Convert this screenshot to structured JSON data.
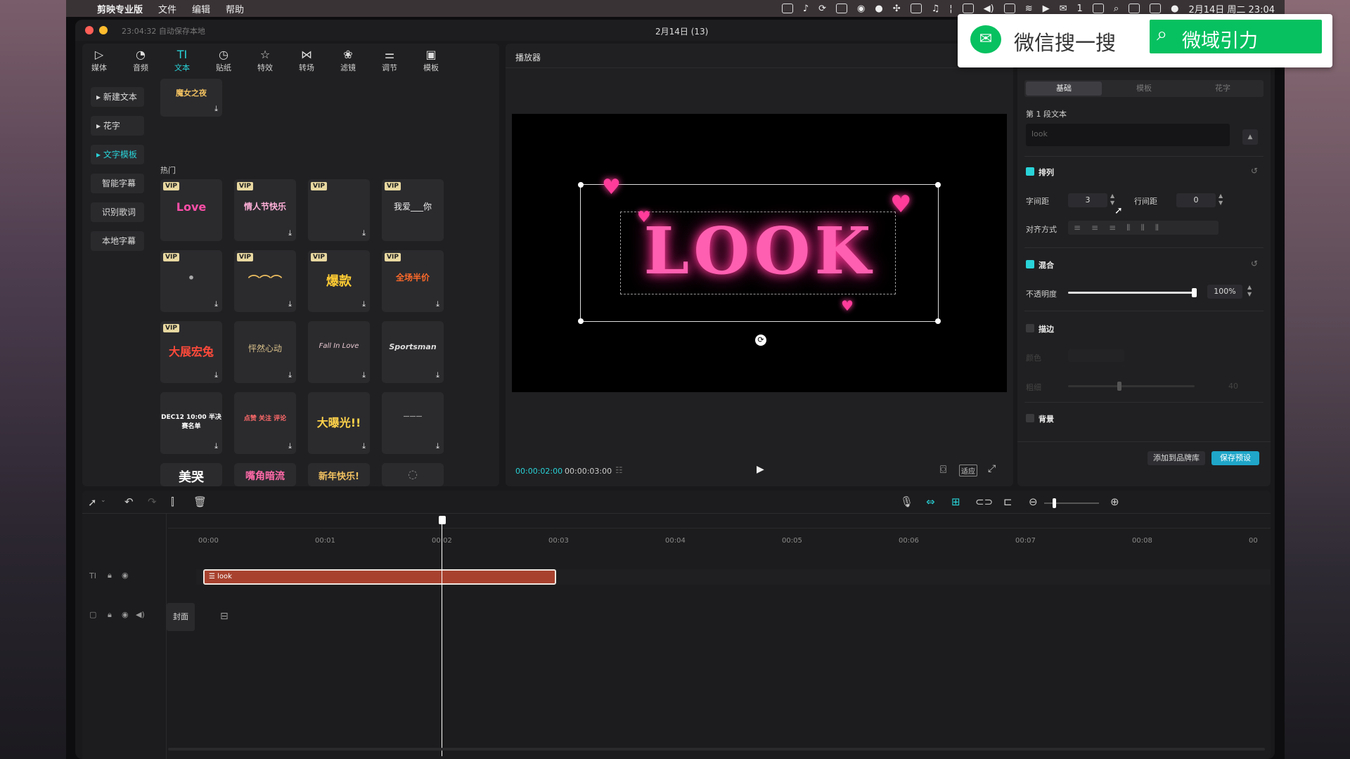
{
  "menubar": {
    "app_name": "剪映专业版",
    "items": [
      "文件",
      "编辑",
      "帮助"
    ],
    "clock": "2月14日 周二 23:04",
    "notif_count": "1"
  },
  "window": {
    "autosave": "23:04:32 自动保存本地",
    "title": "2月14日 (13)"
  },
  "toolbar": [
    "媒体",
    "音频",
    "文本",
    "贴纸",
    "特效",
    "转场",
    "滤镜",
    "调节",
    "模板"
  ],
  "text_sidebar": [
    "新建文本",
    "花字",
    "文字模板",
    "智能字幕",
    "识别歌词",
    "本地字幕"
  ],
  "library": {
    "section_hot": "热门",
    "vip_badge": "VIP",
    "tiles": [
      {
        "art": "魔女之夜"
      },
      {
        "art": "Love"
      },
      {
        "art": "情人节快乐"
      },
      {
        "art": ""
      },
      {
        "art": "我爱___你"
      },
      {
        "art": "•"
      },
      {
        "art": "⌒⌒⌒"
      },
      {
        "art": "爆款"
      },
      {
        "art": "全场半价"
      },
      {
        "art": "大展宏兔"
      },
      {
        "art": "怦然心动"
      },
      {
        "art": "Fall In Love"
      },
      {
        "art": "Sportsman"
      },
      {
        "art": "DEC12 10:00 半决赛名单"
      },
      {
        "art": "点赞 关注 评论"
      },
      {
        "art": "大曝光!!"
      },
      {
        "art": "———"
      },
      {
        "art": "美哭"
      },
      {
        "art": "嘴角暗流"
      },
      {
        "art": "新年快乐!"
      },
      {
        "art": ""
      }
    ]
  },
  "player": {
    "title": "播放器",
    "preview_text": "LOOK",
    "current_time": "00:00:02:00",
    "total_time": "00:00:03:00",
    "fit_label": "适应"
  },
  "inspector": {
    "tabs": [
      "基础",
      "模板",
      "花字"
    ],
    "section_label": "第 1 段文本",
    "text_value": "look",
    "arrange": {
      "title": "排列",
      "char_spacing_label": "字间距",
      "char_spacing": "3",
      "line_spacing_label": "行间距",
      "line_spacing": "0",
      "align_label": "对齐方式"
    },
    "blend": {
      "title": "混合",
      "opacity_label": "不透明度",
      "opacity": "100%",
      "opacity_value": 100
    },
    "stroke": {
      "title": "描边",
      "color_label": "颜色",
      "thickness_label": "粗细",
      "thickness": "40"
    },
    "background": {
      "title": "背景"
    },
    "add_brand_btn": "添加到品牌库",
    "save_preset_btn": "保存预设"
  },
  "timeline": {
    "ticks": [
      "00:00",
      "00:01",
      "00:02",
      "00:03",
      "00:04",
      "00:05",
      "00:06",
      "00:07",
      "00:08",
      "00"
    ],
    "clip_label": "look",
    "cover_label": "封面"
  },
  "wechat_overlay": {
    "left_text": "微信搜一搜",
    "search_text": "微域引力"
  },
  "colors": {
    "accent": "#29d3d8",
    "clip": "#a8422f",
    "pink": "#ff4fa8",
    "wechat_green": "#07c160"
  }
}
